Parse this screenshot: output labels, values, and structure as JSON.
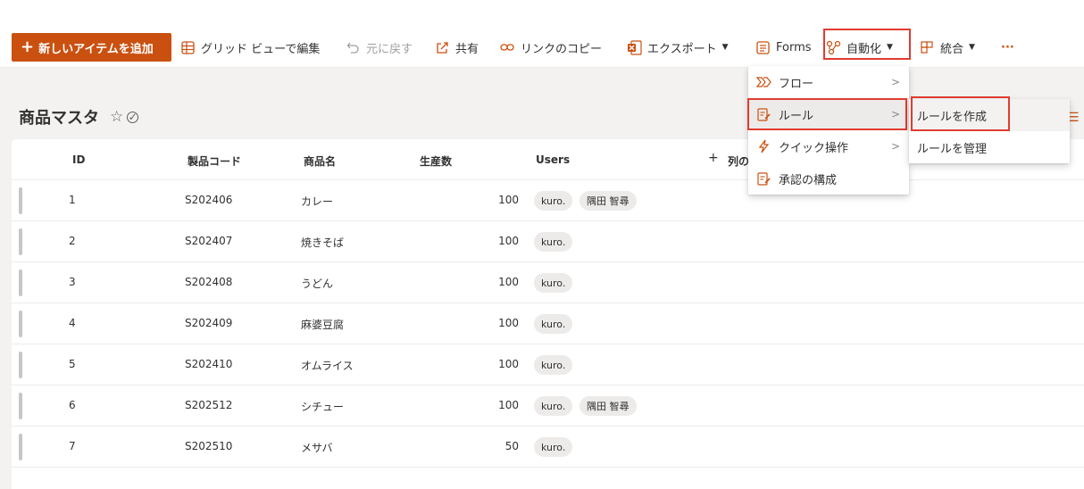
{
  "toolbar": {
    "new_item": "新しいアイテムを追加",
    "grid_edit": "グリッド ビューで編集",
    "undo": "元に戻す",
    "share": "共有",
    "copy_link": "リンクのコピー",
    "export": "エクスポート",
    "forms": "Forms",
    "automate": "自動化",
    "integrate": "統合",
    "more": "···"
  },
  "list": {
    "title": "商品マスタ",
    "star_icon": "☆",
    "columns": {
      "id": "ID",
      "code": "製品コード",
      "name": "商品名",
      "qty": "生産数",
      "users": "Users",
      "add_column": "列の"
    },
    "rows": [
      {
        "id": "1",
        "code": "S202406",
        "name": "カレー",
        "qty": "100",
        "users": [
          "kuro.",
          "隅田 智尋"
        ]
      },
      {
        "id": "2",
        "code": "S202407",
        "name": "焼きそば",
        "qty": "100",
        "users": [
          "kuro."
        ]
      },
      {
        "id": "3",
        "code": "S202408",
        "name": "うどん",
        "qty": "100",
        "users": [
          "kuro."
        ]
      },
      {
        "id": "4",
        "code": "S202409",
        "name": "麻婆豆腐",
        "qty": "100",
        "users": [
          "kuro."
        ]
      },
      {
        "id": "5",
        "code": "S202410",
        "name": "オムライス",
        "qty": "100",
        "users": [
          "kuro."
        ]
      },
      {
        "id": "6",
        "code": "S202512",
        "name": "シチュー",
        "qty": "100",
        "users": [
          "kuro.",
          "隅田 智尋"
        ]
      },
      {
        "id": "7",
        "code": "S202510",
        "name": "メサバ",
        "qty": "50",
        "users": [
          "kuro."
        ]
      }
    ]
  },
  "automate_menu": {
    "items": [
      {
        "label": "フロー",
        "icon": "flow-icon"
      },
      {
        "label": "ルール",
        "icon": "rule-icon"
      },
      {
        "label": "クイック操作",
        "icon": "lightning-icon"
      },
      {
        "label": "承認の構成",
        "icon": "approval-icon"
      }
    ]
  },
  "rules_submenu": {
    "items": [
      {
        "label": "ルールを作成"
      },
      {
        "label": "ルールを管理"
      }
    ]
  },
  "colors": {
    "accent": "#ca5010",
    "highlight": "#e03c31"
  }
}
